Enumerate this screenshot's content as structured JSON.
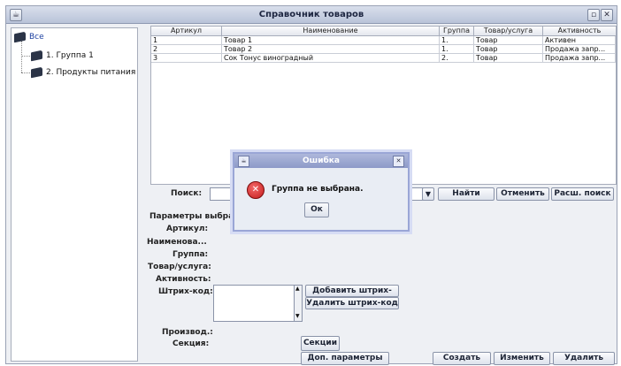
{
  "window": {
    "title": "Справочник товаров"
  },
  "tree": {
    "root": "Все",
    "items": [
      {
        "label": "1. Группа 1"
      },
      {
        "label": "2. Продукты питания"
      }
    ]
  },
  "table": {
    "columns": [
      "Артикул",
      "Наименование",
      "Группа",
      "Товар/услуга",
      "Активность"
    ],
    "rows": [
      [
        "1",
        "Товар 1",
        "1.",
        "Товар",
        "Активен"
      ],
      [
        "2",
        "Товар 2",
        "1.",
        "Товар",
        "Продажа запр..."
      ],
      [
        "3",
        "Сок Тонус виноградный",
        "2.",
        "Товар",
        "Продажа запр..."
      ]
    ]
  },
  "search": {
    "label": "Поиск:",
    "value": "",
    "find": "Найти",
    "cancel": "Отменить",
    "advanced": "Расш. поиск"
  },
  "params": {
    "heading": "Параметры выбран",
    "article": "Артикул:",
    "name": "Наименова...",
    "group": "Группа:",
    "type": "Товар/услуга:",
    "activity": "Активность:",
    "barcode": "Штрих-код:",
    "add_barcode": "Добавить штрих-код",
    "remove_barcode": "Удалить штрих-код",
    "manufacturer": "Производ.:",
    "section": "Секция:",
    "sections_button": "Секции",
    "extra_params_button": "Доп. параметры"
  },
  "actions": {
    "create": "Создать",
    "edit": "Изменить",
    "delete": "Удалить"
  },
  "dialog": {
    "title": "Ошибка",
    "icon": "error-icon",
    "message": "Группа не выбрана.",
    "ok": "Ок"
  },
  "icons": {
    "titlebar": [
      "window-menu-icon",
      "restore-icon",
      "close-icon"
    ],
    "tree": "folder-icon",
    "colors": {
      "titlebar": "#c4cde0",
      "dialog_titlebar": "#9aa6d4",
      "error": "#d62a2a"
    }
  }
}
